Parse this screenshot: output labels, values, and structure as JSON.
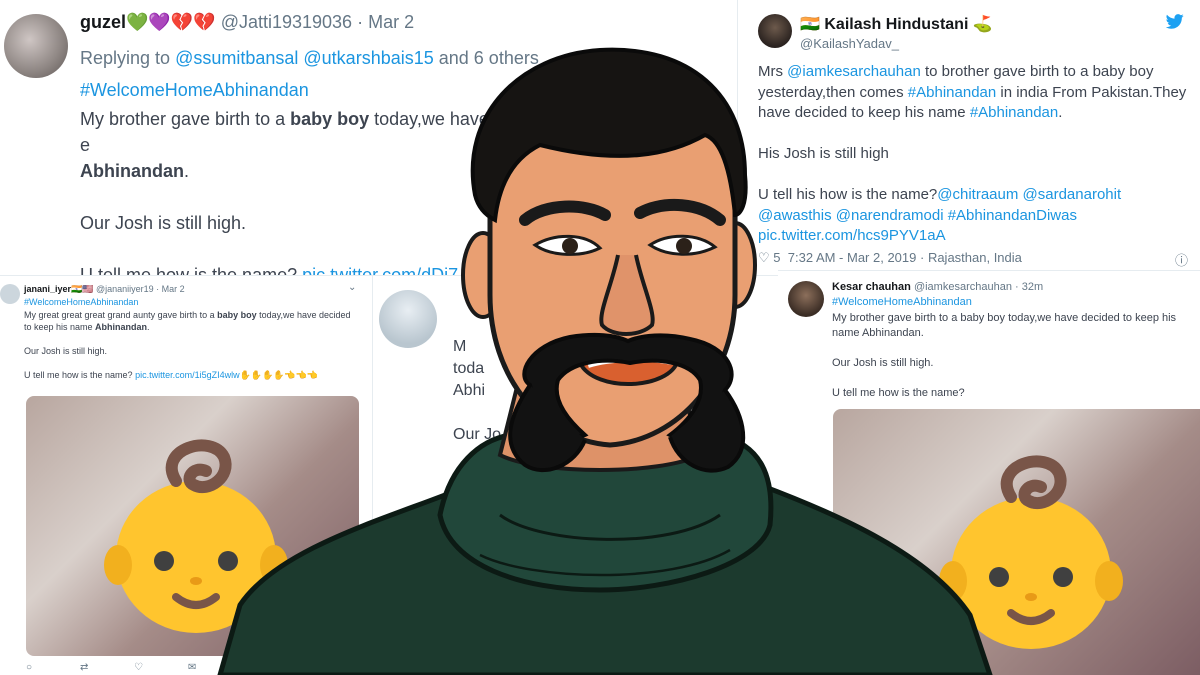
{
  "tweet_top_left": {
    "display_name": "guzel",
    "name_emojis": "💚💜💔💔",
    "handle": "@Jatti19319036",
    "dot": "·",
    "date": "Mar 2",
    "replying_prefix": "Replying to",
    "replying_users": "@ssumitbansal @utkarshbais15",
    "replying_suffix": "and 6 others",
    "hashtag": "#WelcomeHomeAbhinandan",
    "line1_a": "My brother gave birth to a ",
    "line1_bold": "baby boy",
    "line1_b": " today,we have",
    "line1_c": "e",
    "line2_bold": "Abhinandan",
    "line2_b": ".",
    "line3": "Our Josh is still high.",
    "line4": "U tell me how is the name?",
    "link": "pic.twitter.com/dDi7"
  },
  "tweet_top_right": {
    "flag": "🇮🇳",
    "display_name": "Kailash Hindustani",
    "name_emoji": "⛳",
    "handle": "@KailashYadav_",
    "line1_a": "Mrs ",
    "line1_mention": "@iamkesarchauhan",
    "line1_b": " to brother gave birth to a baby boy yesterday,then comes ",
    "line1_tag": "#Abhinandan",
    "line1_c": " in india From Pakistan.They have decided to keep his name ",
    "line1_tag2": "#Abhinandan",
    "line1_d": ".",
    "line2": "His Josh is still high",
    "line3_a": "U tell his how is the name?",
    "line3_mentions": "@chitraaum @sardanarohit @awasthis @narendramodi #AbhinandanDiwas",
    "line3_link": "pic.twitter.com/hcs9PYV1aA",
    "likes": "5",
    "timestamp": "7:32 AM - Mar 2, 2019",
    "location": "Rajasthan, India"
  },
  "tweet_bottom_left": {
    "display_name": "janani_iyer",
    "handle": "@jananiiyer19",
    "date": "Mar 2",
    "hashtag": "#WelcomeHomeAbhinandan",
    "line1_a": "My great great great grand aunty  gave birth to a ",
    "line1_bold": "baby boy",
    "line1_b": " today,we have decided to keep his name ",
    "line1_bold2": "Abhinandan",
    "line1_c": ".",
    "line2": "Our Josh is still high.",
    "line3_a": "U tell me how is the name? ",
    "line3_link": "pic.twitter.com/1i5gZI4wlw",
    "line3_emojis": "✋✋✋✋👈👈👈"
  },
  "tweet_middle": {
    "line1": "M",
    "line2": "toda",
    "line3": "Abhi",
    "line4": "Our Jo"
  },
  "tweet_bottom_right": {
    "display_name": "Kesar chauhan",
    "handle": "@iamkesarchauhan",
    "age": "32m",
    "hashtag": "#WelcomeHomeAbhinandan",
    "line1": "My brother gave birth to a baby boy today,we have decided to keep his name Abhinandan.",
    "line2": "Our Josh is still high.",
    "line3": "U tell me how is the name?"
  },
  "colors": {
    "link": "#1b95e0",
    "muted": "#657786",
    "emoji_face": "#ffc52e",
    "emoji_hair": "#795548",
    "skin": "#e99f72",
    "jacket": "#1c3a2e"
  },
  "icons": [
    "twitter-bird-icon",
    "info-icon",
    "heart-icon",
    "reply-icon",
    "retweet-icon",
    "message-icon",
    "baby-emoji-icon"
  ]
}
